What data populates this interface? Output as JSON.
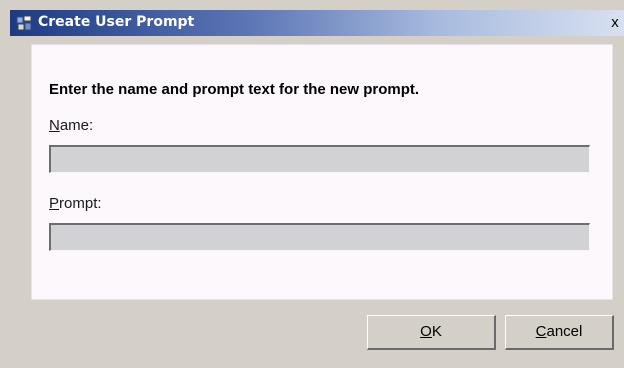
{
  "window": {
    "title": "Create User Prompt",
    "close_glyph": "x",
    "title_icon": "app-icon",
    "colors": {
      "titlebar_start": "#1d3a83",
      "titlebar_end": "#d8e0f0",
      "panel_bg": "#fdf8fb",
      "field_bg": "#d2d1d5",
      "chrome_bg": "#d4d0c8"
    }
  },
  "form": {
    "instruction": "Enter the name and prompt text for the new prompt.",
    "name_label_mnemonic": "N",
    "name_label_rest": "ame:",
    "name_value": "",
    "prompt_label_mnemonic": "P",
    "prompt_label_rest": "rompt:",
    "prompt_value": ""
  },
  "buttons": {
    "ok_mnemonic": "O",
    "ok_rest": "K",
    "cancel_mnemonic": "C",
    "cancel_rest": "ancel"
  }
}
